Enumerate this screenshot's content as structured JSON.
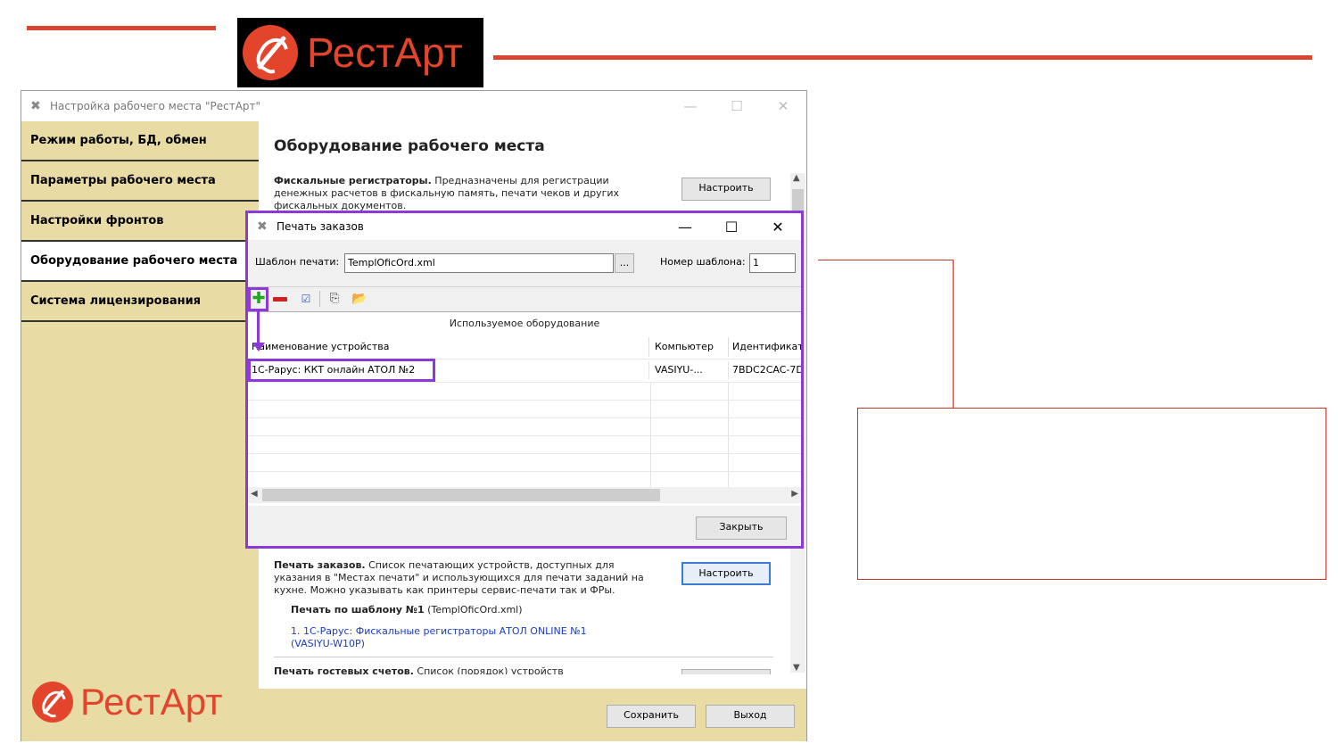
{
  "logo": {
    "text": "РестАрт"
  },
  "window": {
    "title": "Настройка рабочего места \"РестАрт\"",
    "controls": {
      "minimize": "—",
      "maximize": "☐",
      "close": "✕"
    }
  },
  "sidebar": {
    "items": [
      {
        "label": "Режим работы, БД, обмен"
      },
      {
        "label": "Параметры рабочего места"
      },
      {
        "label": "Настройки фронтов"
      },
      {
        "label": "Оборудование рабочего места"
      },
      {
        "label": "Система лицензирования"
      }
    ],
    "logo_text": "РестАрт"
  },
  "content": {
    "title": "Оборудование рабочего места",
    "fiscal": {
      "bold": "Фискальные регистраторы.",
      "text": " Предназначены для регистрации денежных расчетов в фискальную память, печати чеков и других фискальных документов.",
      "button": "Настроить"
    },
    "print_orders": {
      "bold": "Печать заказов.",
      "text": " Список печатающих устройств, доступных для указания в \"Местах печати\" и использующихся для печати заданий на кухне. Можно указывать как принтеры сервис-печати так и ФРы.",
      "button": "Настроить",
      "template_bold": "Печать по шаблону №1",
      "template_file": " (TemplOficOrd.xml)",
      "device_link": "1. 1С-Рарус: Фискальные регистраторы АТОЛ ONLINE №1 (VASIYU-W10P)"
    },
    "guest_bills": {
      "bold": "Печать гостевых счетов.",
      "text": " Список (порядок) устройств"
    },
    "footer": {
      "save": "Сохранить",
      "exit": "Выход"
    }
  },
  "dialog": {
    "title": "Печать заказов",
    "controls": {
      "minimize": "—",
      "maximize": "☐",
      "close": "✕"
    },
    "template_label": "Шаблон печати:",
    "template_value": "TemplOficOrd.xml",
    "browse": "...",
    "number_label": "Номер шаблона:",
    "number_value": "1",
    "grid_title": "Используемое оборудование",
    "columns": [
      "Наименование устройства",
      "Компьютер",
      "Идентификат"
    ],
    "rows": [
      {
        "device": "1С-Рарус: ККТ онлайн АТОЛ №2",
        "computer": "VASIYU-...",
        "id": "7BDC2CAC-7D"
      }
    ],
    "close": "Закрыть"
  }
}
